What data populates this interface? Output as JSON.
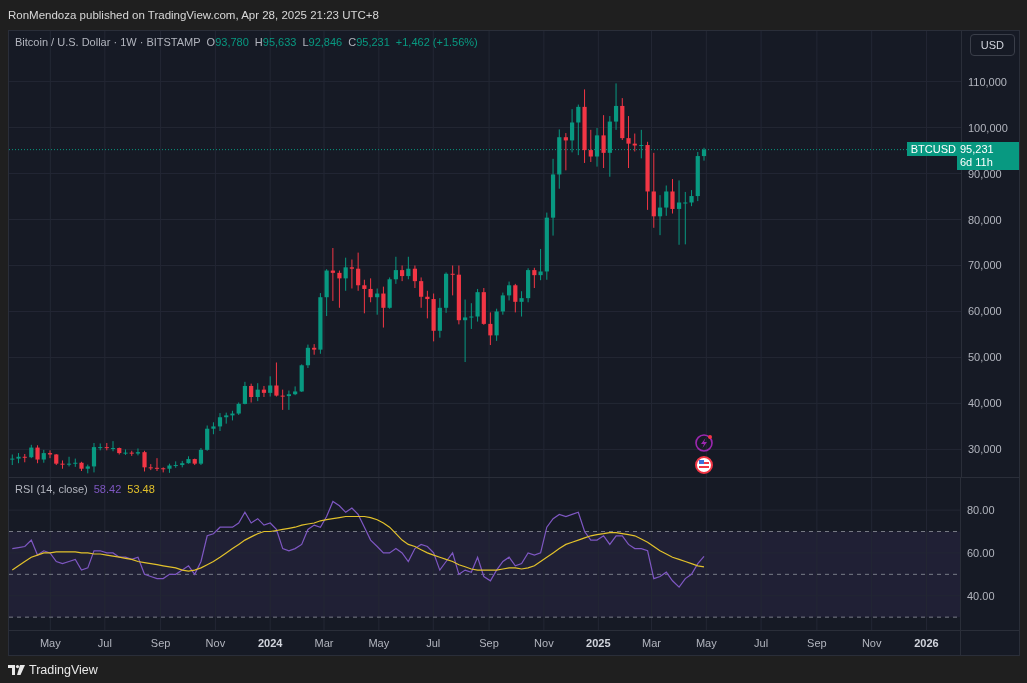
{
  "header": {
    "text": "RonMendoza published on TradingView.com, Apr 28, 2025 21:23 UTC+8"
  },
  "legend": {
    "symbol": "Bitcoin / U.S. Dollar · 1W · BITSTAMP",
    "values": [
      {
        "label": "O",
        "value": "93,780"
      },
      {
        "label": "H",
        "value": "95,633"
      },
      {
        "label": "L",
        "value": "92,846"
      },
      {
        "label": "C",
        "value": "95,231"
      }
    ],
    "change": "+1,462 (+1.56%)"
  },
  "currency_button": "USD",
  "price_tag": {
    "symbol": "BTCUSD",
    "price": "95,231",
    "countdown": "6d 11h"
  },
  "price_chart": {
    "chart_data": {
      "type": "candlestick",
      "grid": true,
      "xlim": [
        2023.204,
        2026.285
      ],
      "ylim": [
        24000,
        121000
      ],
      "yticks": [
        {
          "value": 30000,
          "label": "30,000"
        },
        {
          "value": 40000,
          "label": "40,000"
        },
        {
          "value": 50000,
          "label": "50,000"
        },
        {
          "value": 60000,
          "label": "60,000"
        },
        {
          "value": 70000,
          "label": "70,000"
        },
        {
          "value": 80000,
          "label": "80,000"
        },
        {
          "value": 90000,
          "label": "90,000"
        },
        {
          "value": 100000,
          "label": "100,000"
        },
        {
          "value": 110000,
          "label": "110,000"
        }
      ],
      "ref_lines": [
        {
          "axis": "y",
          "value": 95200,
          "color": "#089981"
        }
      ],
      "x": [
        2023.214,
        2023.233,
        2023.252,
        2023.272,
        2023.291,
        2023.31,
        2023.329,
        2023.348,
        2023.367,
        2023.387,
        2023.406,
        2023.425,
        2023.444,
        2023.463,
        2023.482,
        2023.502,
        2023.521,
        2023.54,
        2023.559,
        2023.578,
        2023.597,
        2023.617,
        2023.636,
        2023.655,
        2023.674,
        2023.693,
        2023.712,
        2023.732,
        2023.751,
        2023.77,
        2023.789,
        2023.808,
        2023.827,
        2023.847,
        2023.866,
        2023.885,
        2023.904,
        2023.923,
        2023.942,
        2023.962,
        2023.981,
        2024,
        2024.019,
        2024.038,
        2024.057,
        2024.076,
        2024.096,
        2024.115,
        2024.134,
        2024.153,
        2024.172,
        2024.191,
        2024.211,
        2024.23,
        2024.249,
        2024.268,
        2024.287,
        2024.306,
        2024.326,
        2024.345,
        2024.364,
        2024.383,
        2024.402,
        2024.421,
        2024.441,
        2024.46,
        2024.479,
        2024.498,
        2024.517,
        2024.536,
        2024.556,
        2024.575,
        2024.594,
        2024.613,
        2024.632,
        2024.651,
        2024.671,
        2024.69,
        2024.709,
        2024.728,
        2024.747,
        2024.766,
        2024.786,
        2024.805,
        2024.824,
        2024.843,
        2024.862,
        2024.881,
        2024.901,
        2024.92,
        2024.939,
        2024.958,
        2024.977,
        2024.996,
        2025.016,
        2025.035,
        2025.054,
        2025.073,
        2025.092,
        2025.111,
        2025.131,
        2025.15,
        2025.169,
        2025.188,
        2025.207,
        2025.226,
        2025.246,
        2025.265,
        2025.284,
        2025.303,
        2025.322
      ],
      "ohlc": [
        [
          28000,
          28900,
          26600,
          28000
        ],
        [
          28000,
          29200,
          27000,
          28400
        ],
        [
          28400,
          29000,
          27200,
          28300
        ],
        [
          28300,
          31000,
          28100,
          30400
        ],
        [
          30400,
          30900,
          27000,
          27800
        ],
        [
          27800,
          29900,
          27100,
          29200
        ],
        [
          29200,
          29800,
          28100,
          28900
        ],
        [
          28900,
          29000,
          26600,
          26900
        ],
        [
          26900,
          27600,
          25800,
          26800
        ],
        [
          26800,
          28400,
          26300,
          26900
        ],
        [
          26900,
          28000,
          26200,
          27100
        ],
        [
          27100,
          27300,
          25300,
          25800
        ],
        [
          25800,
          26700,
          24800,
          26300
        ],
        [
          26300,
          31400,
          25000,
          30500
        ],
        [
          30500,
          31300,
          29800,
          30500
        ],
        [
          30500,
          31400,
          29800,
          30300
        ],
        [
          30300,
          31800,
          29600,
          30300
        ],
        [
          30300,
          30400,
          28900,
          29200
        ],
        [
          29200,
          30000,
          28800,
          29300
        ],
        [
          29300,
          29700,
          28600,
          29100
        ],
        [
          29100,
          30200,
          28700,
          29400
        ],
        [
          29400,
          29700,
          25200,
          26100
        ],
        [
          26100,
          26800,
          25500,
          26000
        ],
        [
          26000,
          28100,
          25300,
          25900
        ],
        [
          25900,
          26100,
          25000,
          25800
        ],
        [
          25800,
          26900,
          24900,
          26500
        ],
        [
          26500,
          27400,
          26000,
          26600
        ],
        [
          26600,
          27500,
          26100,
          27000
        ],
        [
          27000,
          28500,
          26900,
          27900
        ],
        [
          27900,
          28000,
          26600,
          26900
        ],
        [
          26900,
          30300,
          26600,
          29900
        ],
        [
          29900,
          35200,
          29700,
          34500
        ],
        [
          34500,
          35900,
          33300,
          35000
        ],
        [
          35000,
          37900,
          34000,
          37000
        ],
        [
          37000,
          38000,
          35600,
          37400
        ],
        [
          37400,
          38400,
          36300,
          37800
        ],
        [
          37800,
          40200,
          37500,
          39900
        ],
        [
          39900,
          44700,
          39800,
          43800
        ],
        [
          43800,
          44300,
          40200,
          41400
        ],
        [
          41400,
          44400,
          40500,
          43000
        ],
        [
          43000,
          43800,
          41400,
          42300
        ],
        [
          42300,
          45900,
          41500,
          43900
        ],
        [
          43900,
          48900,
          41500,
          41700
        ],
        [
          41700,
          43000,
          38600,
          41600
        ],
        [
          41600,
          42800,
          38600,
          42000
        ],
        [
          42000,
          43700,
          41800,
          42600
        ],
        [
          42600,
          48500,
          42500,
          48300
        ],
        [
          48300,
          52800,
          47700,
          52100
        ],
        [
          52100,
          52900,
          50600,
          51700
        ],
        [
          51700,
          64000,
          50800,
          63100
        ],
        [
          63100,
          69200,
          59000,
          68900
        ],
        [
          68900,
          73800,
          62300,
          68400
        ],
        [
          68400,
          68900,
          60800,
          67200
        ],
        [
          67200,
          71700,
          64500,
          69600
        ],
        [
          69600,
          71300,
          65000,
          69300
        ],
        [
          69300,
          72800,
          64500,
          65700
        ],
        [
          65700,
          66900,
          59600,
          64900
        ],
        [
          64900,
          67200,
          62000,
          63100
        ],
        [
          63100,
          65000,
          59300,
          63900
        ],
        [
          63900,
          65400,
          56500,
          60800
        ],
        [
          60800,
          67400,
          60600,
          67000
        ],
        [
          67000,
          71900,
          66000,
          69000
        ],
        [
          69000,
          70000,
          66600,
          67700
        ],
        [
          67700,
          71900,
          67000,
          69300
        ],
        [
          69300,
          70000,
          65100,
          66600
        ],
        [
          66600,
          67400,
          60800,
          63200
        ],
        [
          63200,
          64500,
          58500,
          62700
        ],
        [
          62700,
          63900,
          53500,
          55800
        ],
        [
          55800,
          62900,
          54300,
          60800
        ],
        [
          60800,
          68500,
          59700,
          68200
        ],
        [
          68200,
          70000,
          63500,
          68000
        ],
        [
          68000,
          70000,
          57200,
          58100
        ],
        [
          58100,
          62600,
          49000,
          58700
        ],
        [
          58700,
          61800,
          56200,
          58900
        ],
        [
          58900,
          64900,
          57800,
          64200
        ],
        [
          64200,
          65100,
          57100,
          57300
        ],
        [
          57300,
          59800,
          52700,
          54800
        ],
        [
          54800,
          60600,
          53600,
          60000
        ],
        [
          60000,
          64100,
          59300,
          63500
        ],
        [
          63500,
          66500,
          62400,
          65700
        ],
        [
          65700,
          66000,
          59800,
          62100
        ],
        [
          62100,
          64400,
          58900,
          62900
        ],
        [
          62900,
          69400,
          62000,
          69000
        ],
        [
          69000,
          69500,
          65100,
          67900
        ],
        [
          67900,
          73600,
          66800,
          68700
        ],
        [
          68700,
          81500,
          66900,
          80400
        ],
        [
          80400,
          93200,
          76500,
          89800
        ],
        [
          89800,
          99600,
          86700,
          97900
        ],
        [
          97900,
          98800,
          90700,
          97200
        ],
        [
          97200,
          104000,
          94600,
          101100
        ],
        [
          101100,
          105000,
          94000,
          104500
        ],
        [
          104500,
          108300,
          92300,
          95100
        ],
        [
          95100,
          99500,
          92500,
          93700
        ],
        [
          93700,
          99900,
          91500,
          98300
        ],
        [
          98300,
          102700,
          91200,
          94500
        ],
        [
          94500,
          102500,
          89300,
          101300
        ],
        [
          101300,
          109600,
          99500,
          104700
        ],
        [
          104700,
          106400,
          97300,
          97700
        ],
        [
          97700,
          102500,
          91200,
          96500
        ],
        [
          96500,
          98700,
          94800,
          96100
        ],
        [
          96100,
          99500,
          93300,
          96200
        ],
        [
          96200,
          96900,
          82100,
          86100
        ],
        [
          86100,
          94500,
          78200,
          80700
        ],
        [
          80700,
          85300,
          76600,
          82600
        ],
        [
          82600,
          87400,
          80800,
          86100
        ],
        [
          86100,
          88800,
          81300,
          82300
        ],
        [
          82300,
          88500,
          74500,
          83700
        ],
        [
          83700,
          86000,
          74600,
          83700
        ],
        [
          83700,
          86400,
          82900,
          85100
        ],
        [
          85100,
          94700,
          84000,
          93800
        ],
        [
          93800,
          95600,
          92800,
          95200
        ]
      ]
    }
  },
  "rsi": {
    "label": "RSI (14, close)",
    "value": "58.42",
    "ma_value": "53.48",
    "chart_data": {
      "type": "line",
      "grid": true,
      "xlim": [
        2023.204,
        2026.285
      ],
      "ylim": [
        24,
        95
      ],
      "yticks": [
        {
          "value": 40,
          "label": "40.00"
        },
        {
          "value": 60,
          "label": "60.00"
        },
        {
          "value": 80,
          "label": "80.00"
        }
      ],
      "xticks": [
        {
          "value": 2023.33,
          "label": "May"
        },
        {
          "value": 2023.496,
          "label": "Jul"
        },
        {
          "value": 2023.666,
          "label": "Sep"
        },
        {
          "value": 2023.833,
          "label": "Nov"
        },
        {
          "value": 2024,
          "label": "2024"
        },
        {
          "value": 2024.164,
          "label": "Mar"
        },
        {
          "value": 2024.331,
          "label": "May"
        },
        {
          "value": 2024.497,
          "label": "Jul"
        },
        {
          "value": 2024.667,
          "label": "Sep"
        },
        {
          "value": 2024.834,
          "label": "Nov"
        },
        {
          "value": 2025,
          "label": "2025"
        },
        {
          "value": 2025.162,
          "label": "Mar"
        },
        {
          "value": 2025.329,
          "label": "May"
        },
        {
          "value": 2025.496,
          "label": "Jul"
        },
        {
          "value": 2025.666,
          "label": "Sep"
        },
        {
          "value": 2025.833,
          "label": "Nov"
        },
        {
          "value": 2026,
          "label": "2026"
        }
      ],
      "ref_lines": [
        {
          "axis": "y",
          "value": 70,
          "color": "#787b86"
        },
        {
          "axis": "y",
          "value": 50,
          "color": "#787b86"
        },
        {
          "axis": "y",
          "value": 30,
          "color": "#787b86"
        }
      ],
      "bands": [
        {
          "axis": "y",
          "from": 30,
          "to": 70,
          "color": "#7e57c2"
        }
      ],
      "x": [
        2023.214,
        2023.233,
        2023.252,
        2023.272,
        2023.291,
        2023.31,
        2023.329,
        2023.348,
        2023.367,
        2023.387,
        2023.406,
        2023.425,
        2023.444,
        2023.463,
        2023.482,
        2023.502,
        2023.521,
        2023.54,
        2023.559,
        2023.578,
        2023.597,
        2023.617,
        2023.636,
        2023.655,
        2023.674,
        2023.693,
        2023.712,
        2023.732,
        2023.751,
        2023.77,
        2023.789,
        2023.808,
        2023.827,
        2023.847,
        2023.866,
        2023.885,
        2023.904,
        2023.923,
        2023.942,
        2023.962,
        2023.981,
        2024,
        2024.019,
        2024.038,
        2024.057,
        2024.076,
        2024.096,
        2024.115,
        2024.134,
        2024.153,
        2024.172,
        2024.191,
        2024.211,
        2024.23,
        2024.249,
        2024.268,
        2024.287,
        2024.306,
        2024.326,
        2024.345,
        2024.364,
        2024.383,
        2024.402,
        2024.421,
        2024.441,
        2024.46,
        2024.479,
        2024.498,
        2024.517,
        2024.536,
        2024.556,
        2024.575,
        2024.594,
        2024.613,
        2024.632,
        2024.651,
        2024.671,
        2024.69,
        2024.709,
        2024.728,
        2024.747,
        2024.766,
        2024.786,
        2024.805,
        2024.824,
        2024.843,
        2024.862,
        2024.881,
        2024.901,
        2024.92,
        2024.939,
        2024.958,
        2024.977,
        2024.996,
        2025.016,
        2025.035,
        2025.054,
        2025.073,
        2025.092,
        2025.111,
        2025.131,
        2025.15,
        2025.169,
        2025.188,
        2025.207,
        2025.226,
        2025.246,
        2025.265,
        2025.284,
        2025.303,
        2025.322
      ],
      "series": [
        {
          "color": "#7e57c2",
          "values": [
            62,
            62.5,
            63,
            66,
            59,
            61,
            60,
            56,
            55,
            56,
            57,
            52,
            53,
            61,
            61,
            60,
            60,
            58,
            58,
            57,
            58,
            50,
            49,
            48,
            48,
            50,
            50,
            52,
            54,
            50,
            56,
            68,
            69,
            72,
            72,
            72,
            74,
            79,
            74,
            76,
            73,
            74,
            71,
            62,
            61,
            62,
            64,
            71,
            73,
            72,
            77,
            84,
            82,
            79,
            81,
            78,
            72,
            66,
            63,
            60,
            60,
            62,
            60,
            56,
            62,
            64,
            63,
            60,
            52,
            56,
            60,
            50,
            52,
            51,
            58,
            49,
            47,
            52,
            56,
            58,
            54,
            55,
            60,
            59,
            60,
            72,
            76,
            78,
            77,
            78,
            79,
            70,
            66,
            66,
            68,
            64,
            68,
            68,
            64,
            62,
            62,
            61,
            48,
            49,
            51,
            47,
            44,
            48,
            50,
            55,
            58.4
          ]
        },
        {
          "color": "#e2c12b",
          "values": [
            52,
            54,
            56,
            58,
            59,
            60,
            60,
            60.5,
            60.5,
            60.5,
            60.5,
            60,
            60,
            59.5,
            59.5,
            59,
            58.5,
            58,
            57.5,
            57,
            56,
            55.5,
            55,
            54.5,
            54,
            53.5,
            53,
            52,
            51.5,
            52,
            53,
            54.5,
            56,
            58,
            60,
            62,
            64,
            66,
            67.5,
            69,
            70,
            70,
            70.5,
            71,
            71.5,
            72,
            73,
            73.5,
            74,
            75,
            75.5,
            76,
            76.5,
            77,
            77,
            77,
            77,
            76.5,
            75.5,
            74,
            72,
            69,
            66,
            64,
            63,
            61.5,
            60,
            59,
            58,
            57,
            56,
            54.5,
            53.5,
            52.5,
            52,
            52,
            52,
            52,
            52.5,
            53,
            53,
            52.5,
            53,
            54,
            56,
            58,
            60,
            62,
            64,
            65,
            66,
            67,
            68,
            68.5,
            69,
            69.5,
            69.5,
            69,
            68.5,
            68,
            66.5,
            65,
            63,
            61,
            59.5,
            58,
            57,
            56,
            55,
            54,
            53.5
          ]
        }
      ]
    }
  },
  "footer": {
    "brand": "TradingView"
  }
}
